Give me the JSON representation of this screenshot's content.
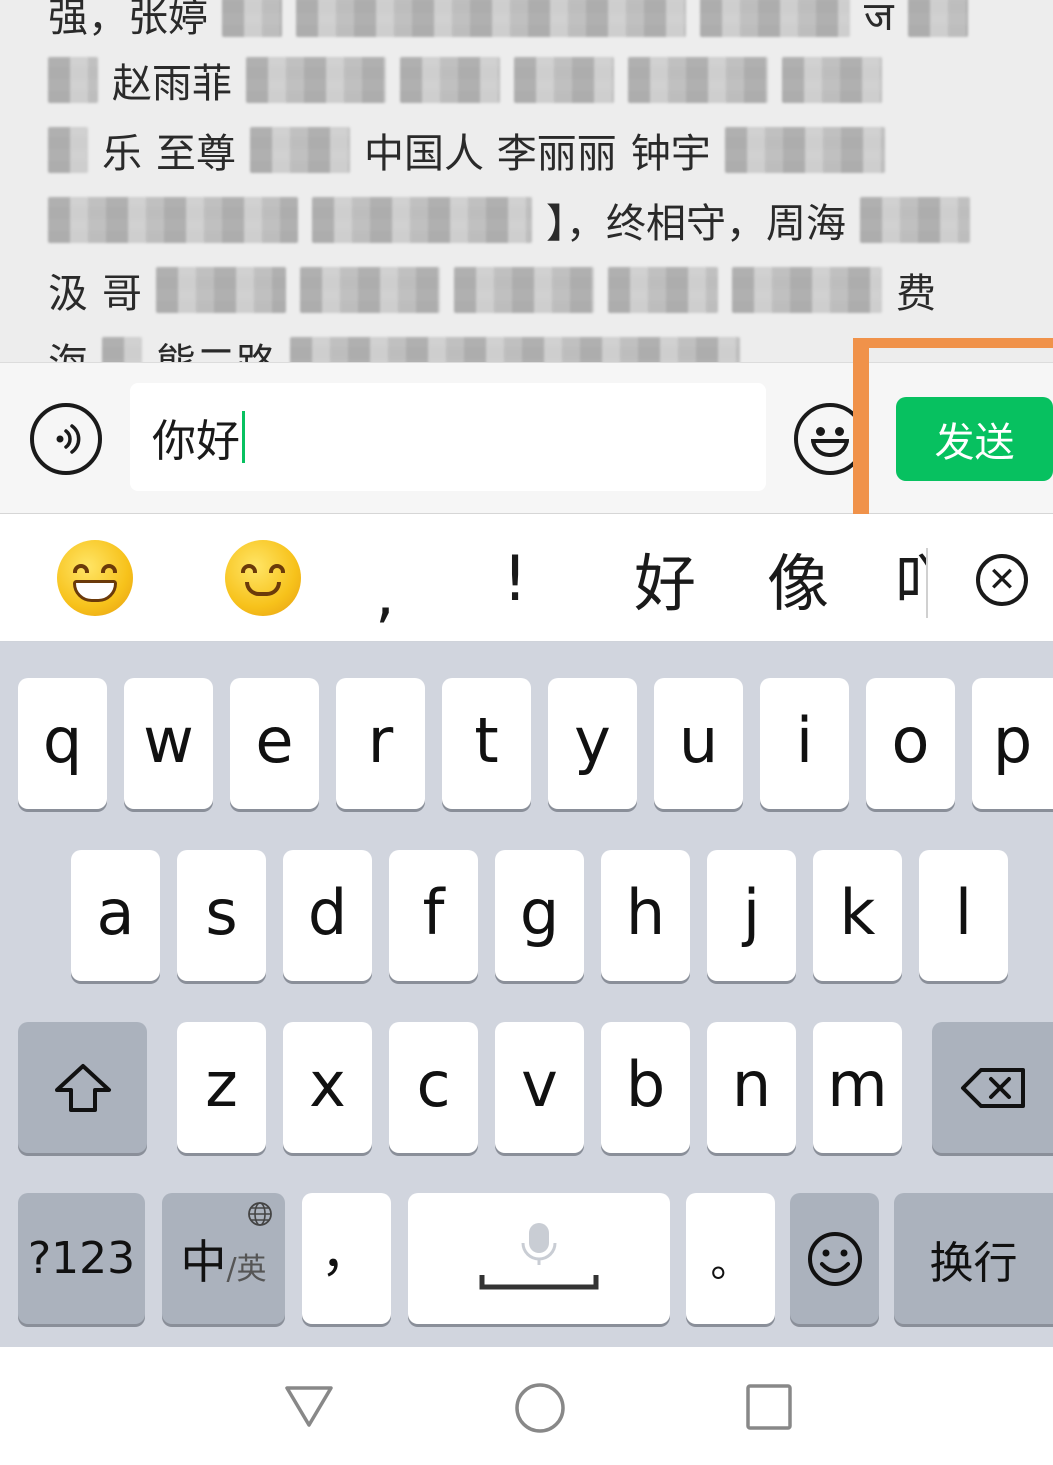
{
  "chat": {
    "lines": [
      {
        "a": "强，张婷",
        "b": "",
        "c": "",
        "d": "",
        "e": "ज"
      },
      {
        "a": "",
        "b": "赵雨菲",
        "c": "",
        "d": "",
        "e": ""
      },
      {
        "a": "乐",
        "b": "至尊",
        "c": "中国人 李丽丽",
        "d": "钟宇",
        "e": ""
      },
      {
        "a": "",
        "b": "",
        "c": "】，终相守，周海",
        "d": "",
        "e": ""
      },
      {
        "a": "汲",
        "b": "哥",
        "c": "",
        "d": "",
        "e": "费"
      },
      {
        "a": "海",
        "b": "熊二路",
        "c": "",
        "d": "",
        "e": ""
      }
    ]
  },
  "input": {
    "value": "你好",
    "send_label": "发送"
  },
  "candidates": {
    "items": [
      ",",
      "!",
      "好",
      "像",
      "吖"
    ]
  },
  "keyboard": {
    "row1": [
      "q",
      "w",
      "e",
      "r",
      "t",
      "y",
      "u",
      "i",
      "o",
      "p"
    ],
    "row2": [
      "a",
      "s",
      "d",
      "f",
      "g",
      "h",
      "j",
      "k",
      "l"
    ],
    "row3": [
      "z",
      "x",
      "c",
      "v",
      "b",
      "n",
      "m"
    ],
    "numbers_label": "?123",
    "lang_main": "中",
    "lang_sub": "/英",
    "comma": "，",
    "period": "。",
    "enter_label": "换行"
  },
  "colors": {
    "accent": "#07c160",
    "highlight": "#f0924a",
    "keyboard_bg": "#d1d5de",
    "func_key": "#abb2bd"
  }
}
